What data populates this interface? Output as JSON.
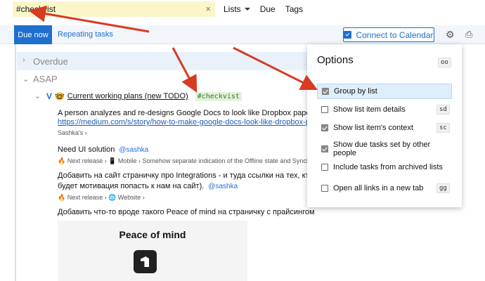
{
  "search": {
    "value": "#checkvist",
    "clear_icon": "×"
  },
  "topnav": {
    "lists": "Lists",
    "due": "Due",
    "tags": "Tags"
  },
  "tabs": {
    "due_now": "Due now",
    "repeating": "Repeating tasks"
  },
  "toolbar": {
    "connect_label": "Connect to Calendar",
    "settings_icon": "gear-icon",
    "print_icon": "printer-icon"
  },
  "sections": {
    "overdue": "Overdue",
    "asap": "ASAP"
  },
  "task": {
    "emoji": "🤓",
    "title": "Current working plans (new TODO)",
    "tag": "#checkvist"
  },
  "items": {
    "l1": "A person analyzes and re-designs Google Docs to look like Dropbox paper. Head",
    "l2": "https://medium.com/s/story/how-to-make-google-docs-look-like-dropbox-paper",
    "l3": "Sashka's ›",
    "l4_text": "Need UI solution",
    "l4_mention": "@sashka",
    "l5": "🔥 Next release › 📱 Mobile › Somehow separate indication of the Offline state and Synching",
    "l6": "Добавить на сайт страничку про Integrations - и туда ссылки на тех, кто с на",
    "l7_text": "будет мотивация попасть к нам на сайт).",
    "l7_mention": "@sashka",
    "l8": "🔥 Next release › 🌐 Website ›",
    "l9": "Добавить что-то вроде такого Peace of mind на страничку с прайсингом",
    "peace_title": "Peace of mind"
  },
  "options": {
    "title": "Options",
    "title_kbd": "oo",
    "rows": [
      {
        "label": "Group by list",
        "checked": true,
        "kbd": ""
      },
      {
        "label": "Show list item details",
        "checked": false,
        "kbd": "sd"
      },
      {
        "label": "Show list item's context",
        "checked": true,
        "kbd": "sc"
      },
      {
        "label": "Show due tasks set by other people",
        "checked": true,
        "kbd": ""
      },
      {
        "label": "Include tasks from archived lists",
        "checked": false,
        "kbd": ""
      },
      {
        "label": "Open all links in a new tab",
        "checked": false,
        "kbd": "gg"
      }
    ]
  },
  "colors": {
    "accent": "#1f6fce",
    "arrow": "#d83a22",
    "search_bg": "#fbf6c8",
    "tag_green": "#2d7d1a"
  }
}
